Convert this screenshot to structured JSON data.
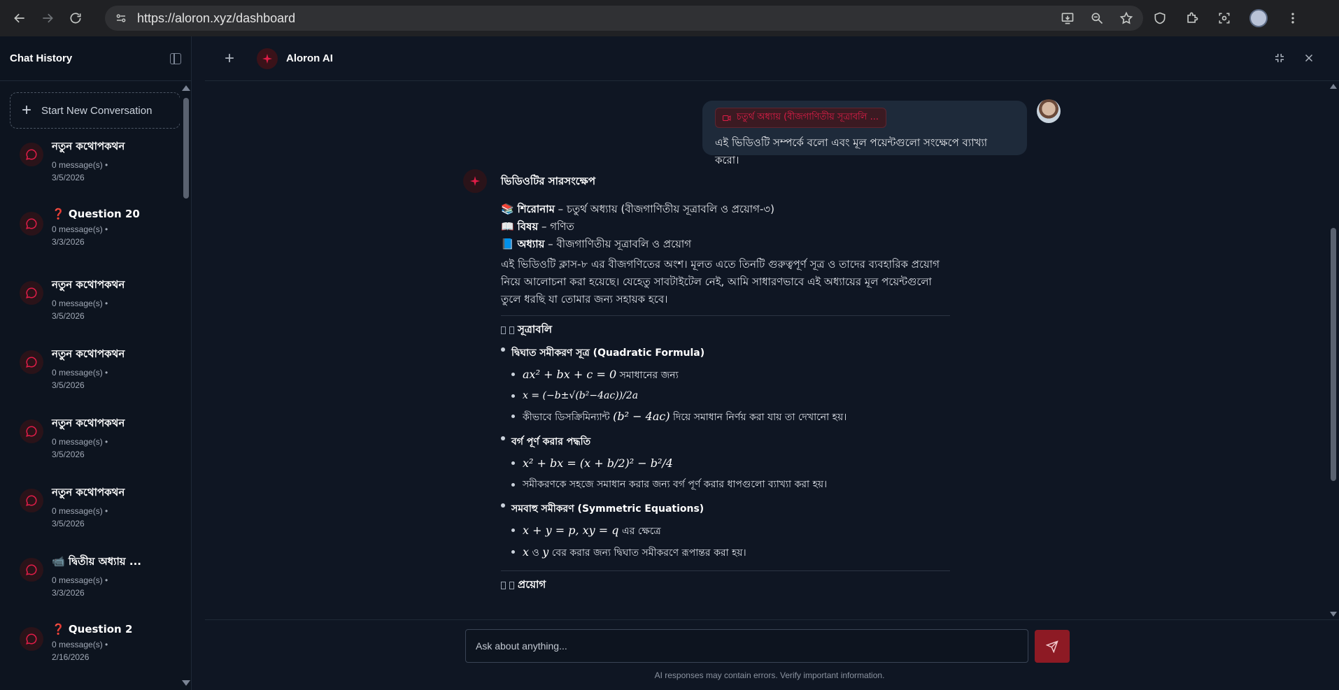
{
  "browser": {
    "url": "https://aloron.xyz/dashboard"
  },
  "sidebar": {
    "title": "Chat History",
    "new_conversation": "Start New Conversation",
    "items": [
      {
        "title": "নতুন কথোপকথন",
        "count": "0 message(s) •",
        "date": "3/5/2026"
      },
      {
        "title": "❓ Question 20",
        "count": "0 message(s) •",
        "date": "3/3/2026"
      },
      {
        "title": "নতুন কথোপকথন",
        "count": "0 message(s) •",
        "date": "3/5/2026"
      },
      {
        "title": "নতুন কথোপকথন",
        "count": "0 message(s) •",
        "date": "3/5/2026"
      },
      {
        "title": "নতুন কথোপকথন",
        "count": "0 message(s) •",
        "date": "3/5/2026"
      },
      {
        "title": "নতুন কথোপকথন",
        "count": "0 message(s) •",
        "date": "3/5/2026"
      },
      {
        "title": "📹 দ্বিতীয় অধ্যায় ...",
        "count": "0 message(s) •",
        "date": "3/3/2026"
      },
      {
        "title": "❓ Question 2",
        "count": "0 message(s) •",
        "date": "2/16/2026"
      }
    ]
  },
  "header": {
    "brand": "Aloron AI"
  },
  "chat": {
    "user": {
      "attachment": "চতুর্থ অধ্যায় (বীজগাণিতীয় সূত্রাবলি ...",
      "message": "এই ভিডিওটি সম্পর্কে বলো এবং মূল পয়েন্টগুলো সংক্ষেপে ব্যাখ্যা করো।"
    },
    "ai": {
      "heading": "ভিডিওটির সারসংক্ষেপ",
      "info": [
        {
          "emoji": "📚",
          "label": "শিরোনাম",
          "value": " – চতুর্থ অধ্যায় (বীজগাণিতীয় সূত্রাবলি ও প্রয়োগ-৩)"
        },
        {
          "emoji": "📖",
          "label": "বিষয়",
          "value": " – গণিত"
        },
        {
          "emoji": "📘",
          "label": "অধ্যায়",
          "value": " – বীজগাণিতীয় সূত্রাবলি ও প্রয়োগ"
        }
      ],
      "paragraph": "এই ভিডিওটি ক্লাস-৮ এর বীজগণিতের অংশ। মূলত এতে তিনটি গুরুত্বপূর্ণ সূত্র ও তাদের ব্যবহারিক প্রয়োগ নিয়ে আলোচনা করা হয়েছে। যেহেতু সাবটাইটেল নেই, আমি সাধারণভাবে এই অধ্যায়ের মূল পয়েন্টগুলো তুলে ধরছি যা তোমার জন্য সহায়ক হবে।",
      "section1": "সূত্রাবলি",
      "topic1": {
        "title": "দ্বিঘাত সমীকরণ সূত্র (Quadratic Formula)",
        "b1_math": "ax² + bx + c = 0",
        "b1_text": " সমাধানের জন্য",
        "b2_math": "x = (−b±√(b²−4ac))/2a",
        "b3_pre": "কীভাবে ডিসক্রিমিন্যান্ট ",
        "b3_math": "(b² − 4ac)",
        "b3_post": " দিয়ে সমাধান নির্ণয় করা যায় তা দেখানো হয়।"
      },
      "topic2": {
        "title": "বর্গ পূর্ণ করার পদ্ধতি",
        "b1_math": "x² + bx = (x + b/2)² − b²/4",
        "b2_text": "সমীকরণকে সহজে সমাধান করার জন্য বর্গ পূর্ণ করার ধাপগুলো ব্যাখ্যা করা হয়।"
      },
      "topic3": {
        "title": "সমবাহু সমীকরণ (Symmetric Equations)",
        "b1_math": "x + y = p,  xy = q",
        "b1_text": " এর ক্ষেত্রে",
        "b2_math_x": "x",
        "b2_mid": " ও ",
        "b2_math_y": "y",
        "b2_text": " বের করার জন্য দ্বিঘাত সমীকরণে রূপান্তর করা হয়।"
      },
      "section2": "প্রয়োগ"
    }
  },
  "composer": {
    "placeholder": "Ask about anything...",
    "disclaimer": "AI responses may contain errors. Verify important information."
  },
  "colors": {
    "accent": "#e11d48",
    "send_bg": "#8d1a24",
    "bg": "#0f1623",
    "sidebar_bg": "#0d141f"
  }
}
